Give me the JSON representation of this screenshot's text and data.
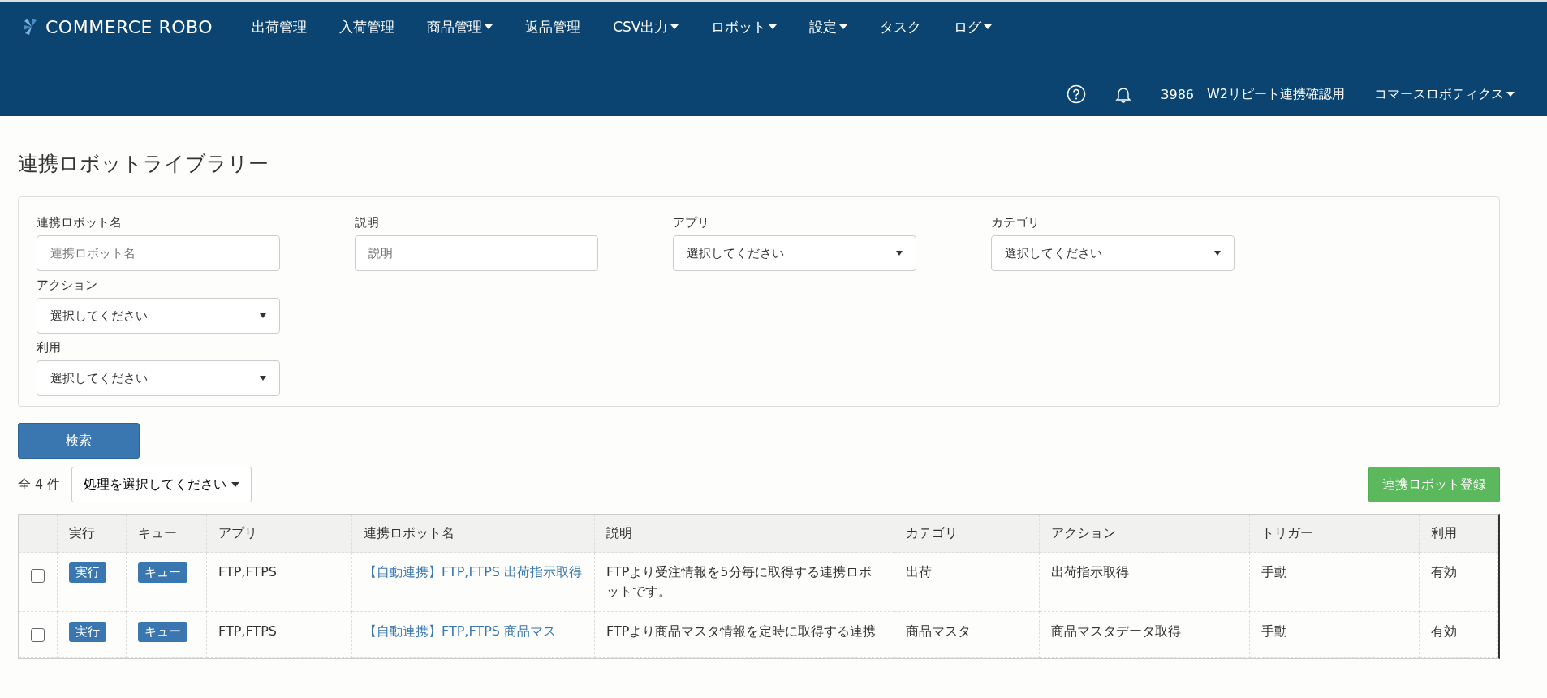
{
  "nav": {
    "logo": "COMMERCE ROBO",
    "items": [
      {
        "label": "出荷管理",
        "dropdown": false
      },
      {
        "label": "入荷管理",
        "dropdown": false
      },
      {
        "label": "商品管理",
        "dropdown": true
      },
      {
        "label": "返品管理",
        "dropdown": false
      },
      {
        "label": "CSV出力",
        "dropdown": true
      },
      {
        "label": "ロボット",
        "dropdown": true
      },
      {
        "label": "設定",
        "dropdown": true
      },
      {
        "label": "タスク",
        "dropdown": false
      },
      {
        "label": "ログ",
        "dropdown": true
      }
    ],
    "account_id": "3986",
    "shop_name": "W2リピート連携確認用",
    "user_menu": "コマースロボティクス"
  },
  "page_title": "連携ロボットライブラリー",
  "filters": [
    {
      "kind": "text",
      "label": "連携ロボット名",
      "placeholder": "連携ロボット名"
    },
    {
      "kind": "text",
      "label": "説明",
      "placeholder": "説明"
    },
    {
      "kind": "select",
      "label": "アプリ",
      "value": "選択してください"
    },
    {
      "kind": "select",
      "label": "カテゴリ",
      "value": "選択してください"
    },
    {
      "kind": "select",
      "label": "アクション",
      "value": "選択してください"
    },
    {
      "kind": "select",
      "label": "利用",
      "value": "選択してください"
    }
  ],
  "search_button": "検索",
  "result_count": "全 4 件",
  "bulk_action": "処理を選択してください",
  "register_button": "連携ロボット登録",
  "table": {
    "columns": [
      "実行",
      "キュー",
      "アプリ",
      "連携ロボット名",
      "説明",
      "カテゴリ",
      "アクション",
      "トリガー",
      "利用"
    ],
    "rows": [
      {
        "checked": false,
        "run": "実行",
        "queue": "キュー",
        "app": "FTP,FTPS",
        "name": "【自動連携】FTP,FTPS 出荷指示取得",
        "description": "FTPより受注情報を5分毎に取得する連携ロボットです。",
        "category": "出荷",
        "action": "出荷指示取得",
        "trigger": "手動",
        "usage": "有効"
      },
      {
        "checked": false,
        "run": "実行",
        "queue": "キュー",
        "app": "FTP,FTPS",
        "name": "【自動連携】FTP,FTPS 商品マス",
        "description": "FTPより商品マスタ情報を定時に取得する連携",
        "category": "商品マスタ",
        "action": "商品マスタデータ取得",
        "trigger": "手動",
        "usage": "有効"
      }
    ]
  }
}
